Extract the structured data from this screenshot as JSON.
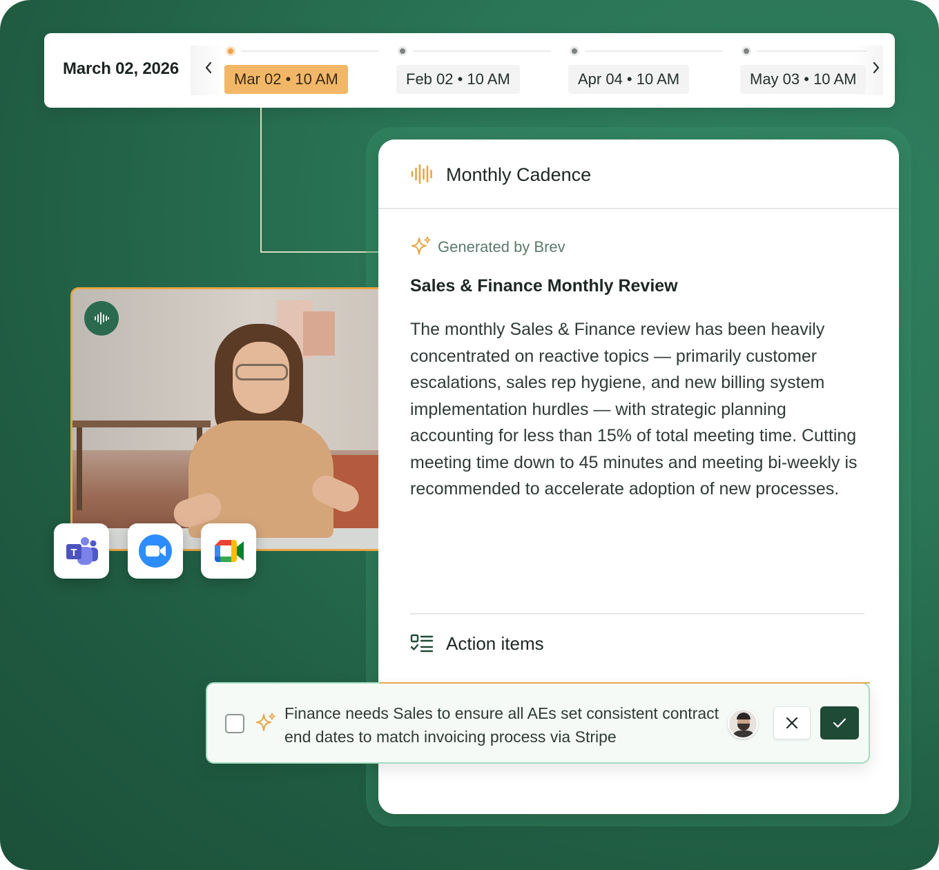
{
  "timeline": {
    "selected_date": "March 02, 2026",
    "items": [
      {
        "label": "Mar 02 • 10 AM",
        "active": true
      },
      {
        "label": "Feb 02 • 10 AM",
        "active": false
      },
      {
        "label": "Apr 04 • 10 AM",
        "active": false
      },
      {
        "label": "May 03 • 10 AM",
        "active": false
      }
    ],
    "prev_icon": "chevron-left-icon",
    "next_icon": "chevron-right-icon"
  },
  "card": {
    "title": "Monthly Cadence",
    "generated_label": "Generated by Brev",
    "review_title": "Sales & Finance Monthly Review",
    "review_body": "The monthly Sales & Finance review has been heavily concentrated on reactive topics — primarily customer escalations, sales rep hygiene, and new billing system implementation hurdles  — with strategic planning accounting for less than 15% of total meeting time. Cutting meeting time down to 45 minutes and meeting bi-weekly is recommended to accelerate adoption of new processes.",
    "action_items_label": "Action items"
  },
  "action_item": {
    "text": "Finance needs Sales to ensure all AEs set consistent contract end dates to match invoicing process via Stripe",
    "checked": false
  },
  "apps": [
    "teams-icon",
    "zoom-icon",
    "google-meet-icon"
  ],
  "colors": {
    "background": "#2a7556",
    "accent_orange": "#f2b766",
    "accept_button": "#1e4a36",
    "brev_green": "#5b7a6c"
  }
}
